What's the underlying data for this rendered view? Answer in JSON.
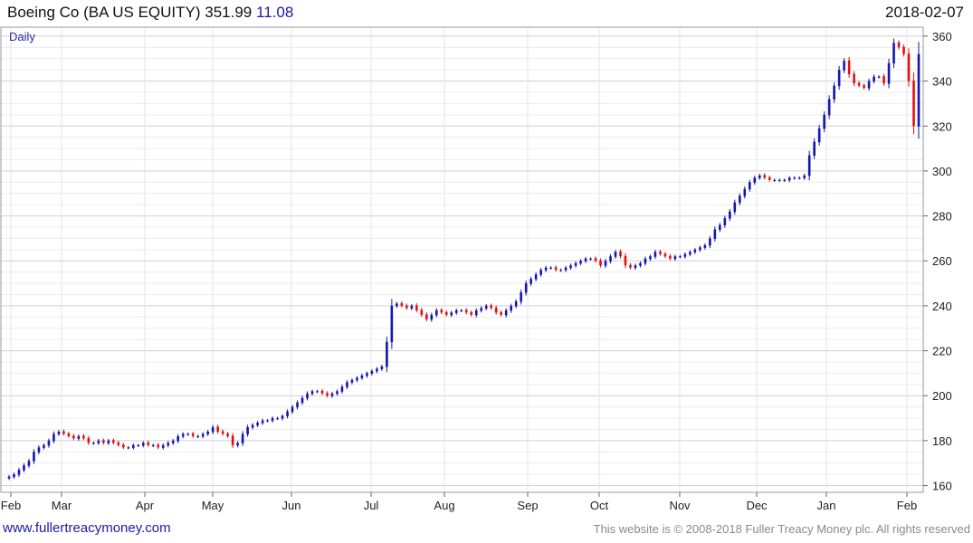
{
  "header": {
    "title": "Boeing Co (BA US EQUITY)",
    "last": "351.99",
    "change": "11.08",
    "date": "2018-02-07"
  },
  "footer": {
    "site": "www.fullertreacymoney.com",
    "copyright": "This website is © 2008-2018 Fuller Treacy Money plc. All rights reserved"
  },
  "colors": {
    "up": "#1515b0",
    "down": "#e01010",
    "grid": "#d8d8d8",
    "frame": "#9a9a9a"
  },
  "chart_data": {
    "type": "candlestick",
    "period": "Daily",
    "x_tick_labels": [
      "Feb",
      "Mar",
      "Apr",
      "May",
      "Jun",
      "Jul",
      "Aug",
      "Sep",
      "Oct",
      "Nov",
      "Dec",
      "Jan",
      "Feb"
    ],
    "y_ticks": [
      160,
      180,
      200,
      220,
      240,
      260,
      280,
      300,
      320,
      340,
      360
    ],
    "ylim": [
      157,
      364
    ],
    "grid": true,
    "series": [
      {
        "values": [
          164,
          165,
          167,
          169,
          171,
          175,
          177,
          178,
          180,
          183,
          184,
          183,
          182,
          181,
          182,
          181,
          179,
          179,
          180,
          179,
          180,
          179,
          178,
          177,
          177,
          178,
          178,
          179,
          178,
          178,
          177,
          178,
          179,
          180,
          182,
          183,
          183,
          182,
          182,
          183,
          184,
          186,
          184,
          183,
          182,
          178,
          179,
          183,
          186,
          187,
          188,
          189,
          189,
          190,
          190,
          191,
          193,
          195,
          197,
          199,
          201,
          202,
          202,
          201,
          200,
          201,
          202,
          204,
          206,
          207,
          208,
          209,
          210,
          211,
          212,
          213,
          224,
          240,
          241,
          240,
          239,
          240,
          238,
          236,
          234,
          236,
          238,
          237,
          236,
          237,
          238,
          238,
          237,
          236,
          238,
          239,
          240,
          239,
          237,
          236,
          238,
          240,
          242,
          246,
          250,
          252,
          254,
          256,
          257,
          257,
          256,
          256,
          257,
          258,
          259,
          260,
          261,
          261,
          260,
          258,
          260,
          262,
          264,
          262,
          258,
          257,
          258,
          259,
          261,
          262,
          264,
          263,
          262,
          261,
          262,
          262,
          263,
          264,
          265,
          266,
          267,
          270,
          274,
          276,
          279,
          282,
          286,
          289,
          292,
          295,
          297,
          298,
          297,
          296,
          296,
          296,
          296,
          297,
          297,
          297,
          298,
          307,
          313,
          319,
          325,
          332,
          338,
          345,
          349,
          343,
          339,
          338,
          337,
          340,
          342,
          342,
          339,
          348,
          357,
          355,
          352,
          340,
          320,
          352
        ]
      }
    ]
  }
}
